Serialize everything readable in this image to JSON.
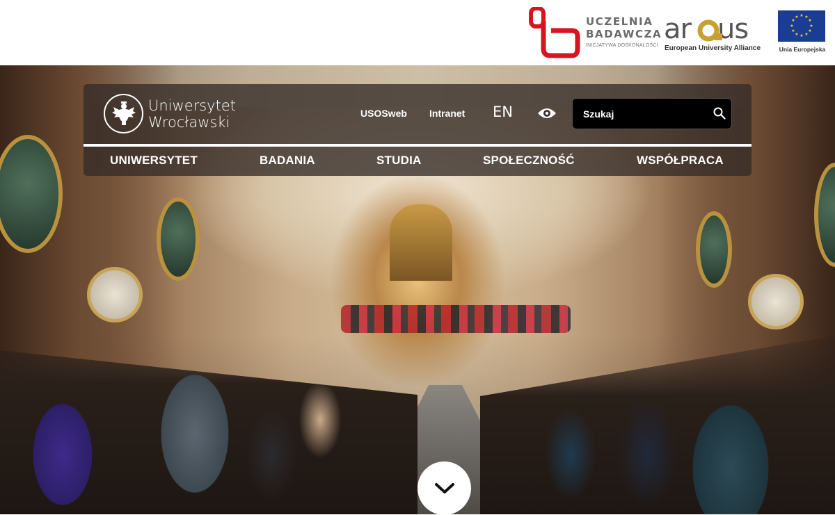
{
  "header": {
    "research_university": {
      "line1": "UCZELNIA",
      "line2": "BADAWCZA",
      "line3": "INICJATYWA DOSKONAŁOŚCI",
      "accent_color": "#d7141f"
    },
    "arqus": {
      "word_ar": "ar",
      "word_us": "us",
      "subtitle": "European University Alliance",
      "accent_color": "#c8a031"
    },
    "eu": {
      "label": "Unia Europejska",
      "flag_color": "#1a3d93",
      "star_color": "#f8d42a"
    }
  },
  "nav": {
    "logo": {
      "line1": "Uniwersytet",
      "line2": "Wrocławski",
      "emblem": "eagle-emblem-icon"
    },
    "utility_links": {
      "usos": "USOSweb",
      "intranet": "Intranet",
      "language": "EN",
      "accessibility_icon": "eye-icon"
    },
    "search": {
      "placeholder": "Szukaj",
      "icon": "search-icon"
    },
    "main_menu": [
      "UNIWERSYTET",
      "BADANIA",
      "STUDIA",
      "SPOŁECZNOŚĆ",
      "WSPÓŁPRACA"
    ]
  },
  "hero": {
    "scroll_icon": "chevron-down-icon"
  }
}
